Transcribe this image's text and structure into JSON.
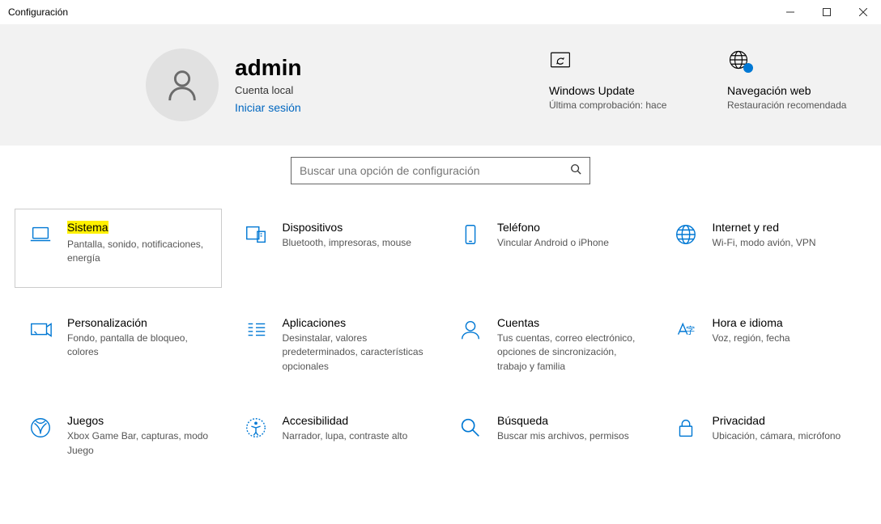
{
  "window": {
    "title": "Configuración"
  },
  "user": {
    "name": "admin",
    "account_type": "Cuenta local",
    "signin": "Iniciar sesión"
  },
  "status": {
    "update": {
      "title": "Windows Update",
      "desc": "Última comprobación: hace"
    },
    "web": {
      "title": "Navegación web",
      "desc": "Restauración recomendada"
    }
  },
  "search": {
    "placeholder": "Buscar una opción de configuración"
  },
  "tiles": {
    "sistema": {
      "title": "Sistema",
      "desc": "Pantalla, sonido, notificaciones, energía"
    },
    "dispositivos": {
      "title": "Dispositivos",
      "desc": "Bluetooth, impresoras, mouse"
    },
    "telefono": {
      "title": "Teléfono",
      "desc": "Vincular Android o iPhone"
    },
    "internet": {
      "title": "Internet y red",
      "desc": "Wi-Fi, modo avión, VPN"
    },
    "personalizacion": {
      "title": "Personalización",
      "desc": "Fondo, pantalla de bloqueo, colores"
    },
    "aplicaciones": {
      "title": "Aplicaciones",
      "desc": "Desinstalar, valores predeterminados, características opcionales"
    },
    "cuentas": {
      "title": "Cuentas",
      "desc": "Tus cuentas, correo electrónico, opciones de sincronización, trabajo y familia"
    },
    "horaidioma": {
      "title": "Hora e idioma",
      "desc": "Voz, región, fecha"
    },
    "juegos": {
      "title": "Juegos",
      "desc": "Xbox Game Bar, capturas, modo Juego"
    },
    "accesibilidad": {
      "title": "Accesibilidad",
      "desc": "Narrador, lupa, contraste alto"
    },
    "busqueda": {
      "title": "Búsqueda",
      "desc": "Buscar mis archivos, permisos"
    },
    "privacidad": {
      "title": "Privacidad",
      "desc": "Ubicación, cámara, micrófono"
    }
  }
}
